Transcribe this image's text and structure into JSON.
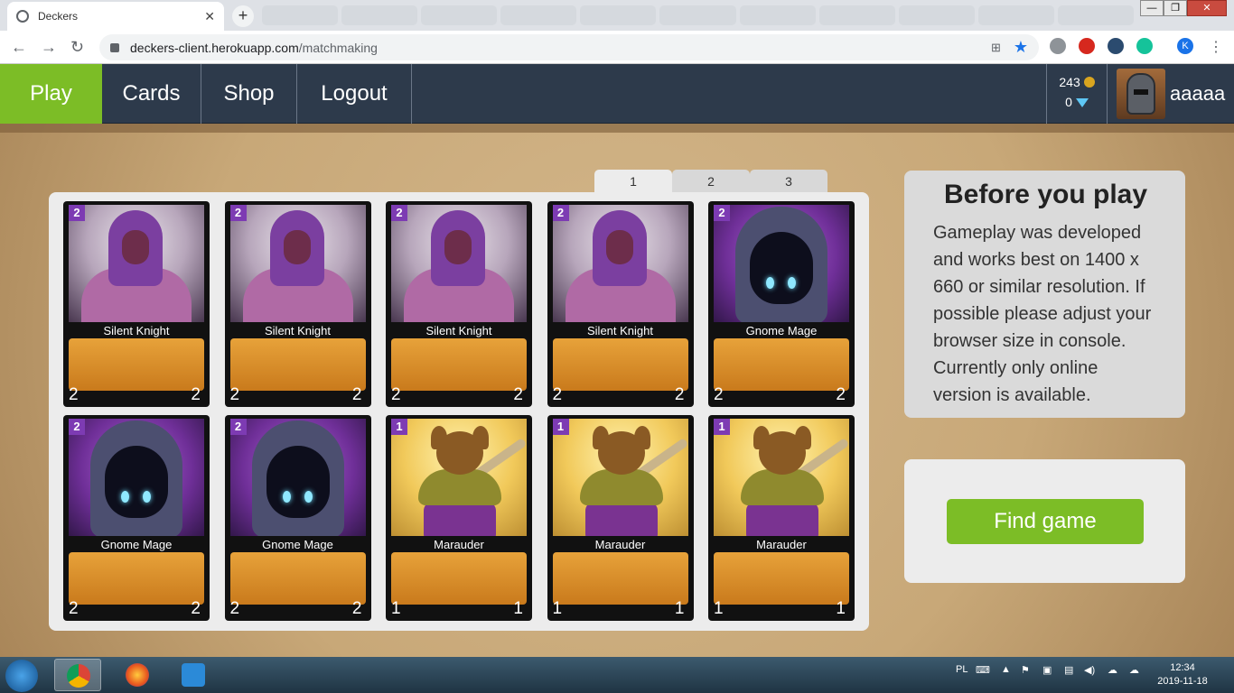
{
  "browser": {
    "tab_title": "Deckers",
    "tab_close": "✕",
    "new_tab": "+",
    "url_host": "deckers-client.herokuapp.com",
    "url_path": "/matchmaking",
    "window_controls": {
      "minimize": "—",
      "maximize": "❐",
      "close": "✕"
    },
    "nav": {
      "back": "←",
      "forward": "→",
      "reload": "↻"
    },
    "star": "★",
    "translate": "⊞",
    "profile_initial": "K"
  },
  "appnav": {
    "items": [
      "Play",
      "Cards",
      "Shop",
      "Logout"
    ],
    "active": "Play",
    "gold": "243",
    "gems": "0",
    "username": "aaaaa"
  },
  "deck": {
    "page_tabs": [
      "1",
      "2",
      "3"
    ],
    "active_page": "1",
    "cards": [
      {
        "name": "Silent Knight",
        "cost": "2",
        "attack": "2",
        "health": "2",
        "art": "knight"
      },
      {
        "name": "Silent Knight",
        "cost": "2",
        "attack": "2",
        "health": "2",
        "art": "knight"
      },
      {
        "name": "Silent Knight",
        "cost": "2",
        "attack": "2",
        "health": "2",
        "art": "knight"
      },
      {
        "name": "Silent Knight",
        "cost": "2",
        "attack": "2",
        "health": "2",
        "art": "knight"
      },
      {
        "name": "Gnome Mage",
        "cost": "2",
        "attack": "2",
        "health": "2",
        "art": "mage"
      },
      {
        "name": "Gnome Mage",
        "cost": "2",
        "attack": "2",
        "health": "2",
        "art": "mage"
      },
      {
        "name": "Gnome Mage",
        "cost": "2",
        "attack": "2",
        "health": "2",
        "art": "mage"
      },
      {
        "name": "Marauder",
        "cost": "1",
        "attack": "1",
        "health": "1",
        "art": "marauder"
      },
      {
        "name": "Marauder",
        "cost": "1",
        "attack": "1",
        "health": "1",
        "art": "marauder"
      },
      {
        "name": "Marauder",
        "cost": "1",
        "attack": "1",
        "health": "1",
        "art": "marauder"
      }
    ]
  },
  "info": {
    "title": "Before you play",
    "body": "Gameplay was developed and works best on 1400 x 660 or similar resolution. If possible please adjust your browser size in console. Currently only online version is available."
  },
  "find_game": {
    "label": "Find game"
  },
  "taskbar": {
    "language": "PL",
    "time": "12:34",
    "date": "2019-11-18"
  },
  "colors": {
    "accent_green": "#7cbd26",
    "nav_bg": "#2d3a4b",
    "cost_badge": "#7d3bb3"
  }
}
